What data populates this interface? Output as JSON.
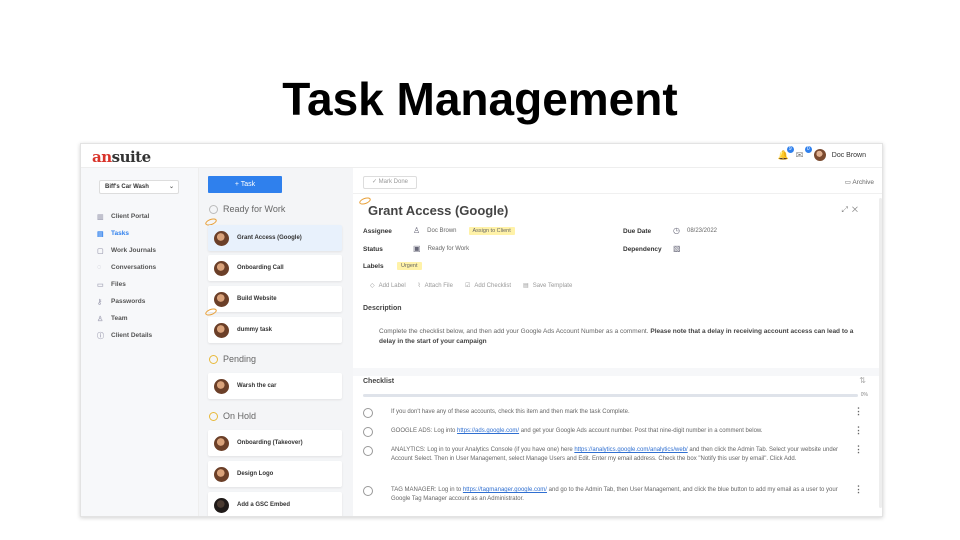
{
  "slide": {
    "title": "Task Management"
  },
  "brand": {
    "logo_prefix": "an",
    "logo_suffix": "suite"
  },
  "topbar": {
    "notif_count_1": "9",
    "notif_count_2": "0",
    "user_name": "Doc Brown"
  },
  "sidebar": {
    "client_select": "Biff's Car Wash",
    "items": [
      {
        "label": "Client Portal",
        "icon": "chart-icon",
        "active": false
      },
      {
        "label": "Tasks",
        "icon": "list-icon",
        "active": true
      },
      {
        "label": "Work Journals",
        "icon": "journal-icon",
        "active": false
      },
      {
        "label": "Conversations",
        "icon": "chat-icon",
        "active": false
      },
      {
        "label": "Files",
        "icon": "folder-icon",
        "active": false
      },
      {
        "label": "Passwords",
        "icon": "key-icon",
        "active": false
      },
      {
        "label": "Team",
        "icon": "team-icon",
        "active": false
      },
      {
        "label": "Client Details",
        "icon": "info-icon",
        "active": false
      }
    ]
  },
  "tasklist": {
    "add_label": "+ Task",
    "groups": [
      {
        "name": "Ready for Work",
        "tasks": [
          "Grant Access (Google)",
          "Onboarding Call",
          "Build Website",
          "dummy task"
        ]
      },
      {
        "name": "Pending",
        "tasks": [
          "Warsh the car"
        ]
      },
      {
        "name": "On Hold",
        "tasks": [
          "Onboarding (Takeover)",
          "Design Logo",
          "Add a GSC Embed"
        ]
      }
    ]
  },
  "detail": {
    "mark_done": "✓ Mark Done",
    "archive": "Archive",
    "title": "Grant Access (Google)",
    "assignee_label": "Assignee",
    "assignee": "Doc Brown",
    "assign_client": "Assign to Client",
    "due_label": "Due Date",
    "due": "08/23/2022",
    "status_label": "Status",
    "status": "Ready for Work",
    "dependency_label": "Dependency",
    "labels_label": "Labels",
    "label_tag": "Urgent",
    "actions": [
      "Add Label",
      "Attach File",
      "Add Checklist",
      "Save Template"
    ],
    "description_label": "Description",
    "description_plain": "Complete the checklist below, and then add your Google Ads Account Number as a comment. ",
    "description_bold": "Please note that a delay in receiving account access can lead to a delay in the start of your campaign",
    "checklist_label": "Checklist",
    "progress_pct": 0,
    "progress_text": "0%",
    "checklist": [
      {
        "pre": "If you don't have any of these accounts, check this item and then mark the task Complete.",
        "link": "",
        "post": ""
      },
      {
        "pre": "GOOGLE ADS: Log into ",
        "link": "https://ads.google.com/",
        "post": " and get your Google Ads account number. Post that nine-digit number in a comment below."
      },
      {
        "pre": "ANALYTICS: Log in to your Analytics Console (if you have one) here ",
        "link": "https://analytics.google.com/analytics/web/",
        "post": " and then click the Admin Tab. Select your website under Account Select. Then in User Management, select Manage Users and Edit. Enter my email address. Check the box \"Notify this user by email\". Click Add."
      },
      {
        "pre": "TAG MANAGER: Log in to ",
        "link": "https://tagmanager.google.com/",
        "post": " and go to the Admin Tab, then User Management, and click the blue button to add my email as a user to your Google Tag Manager account as an Administrator."
      }
    ]
  }
}
